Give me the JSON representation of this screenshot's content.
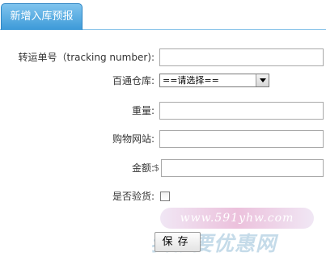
{
  "tab": {
    "label": "新增入库预报"
  },
  "form": {
    "tracking": {
      "label": "转运单号（tracking number):",
      "value": ""
    },
    "warehouse": {
      "label": "百通仓库:",
      "selected": "==请选择=="
    },
    "weight": {
      "label": "重量:",
      "value": ""
    },
    "shop_site": {
      "label": "购物网站:",
      "value": ""
    },
    "amount": {
      "label": "金额:",
      "currency": "$",
      "value": ""
    },
    "inspect": {
      "label": "是否验货:",
      "checked": false
    }
  },
  "save_button": {
    "label": "保存"
  },
  "watermark": {
    "url": "www.591yhw.com",
    "slogan": "我就要优惠网"
  },
  "colors": {
    "tab_bg": "#3d9ad8",
    "tab_border": "#8ec6ea"
  }
}
